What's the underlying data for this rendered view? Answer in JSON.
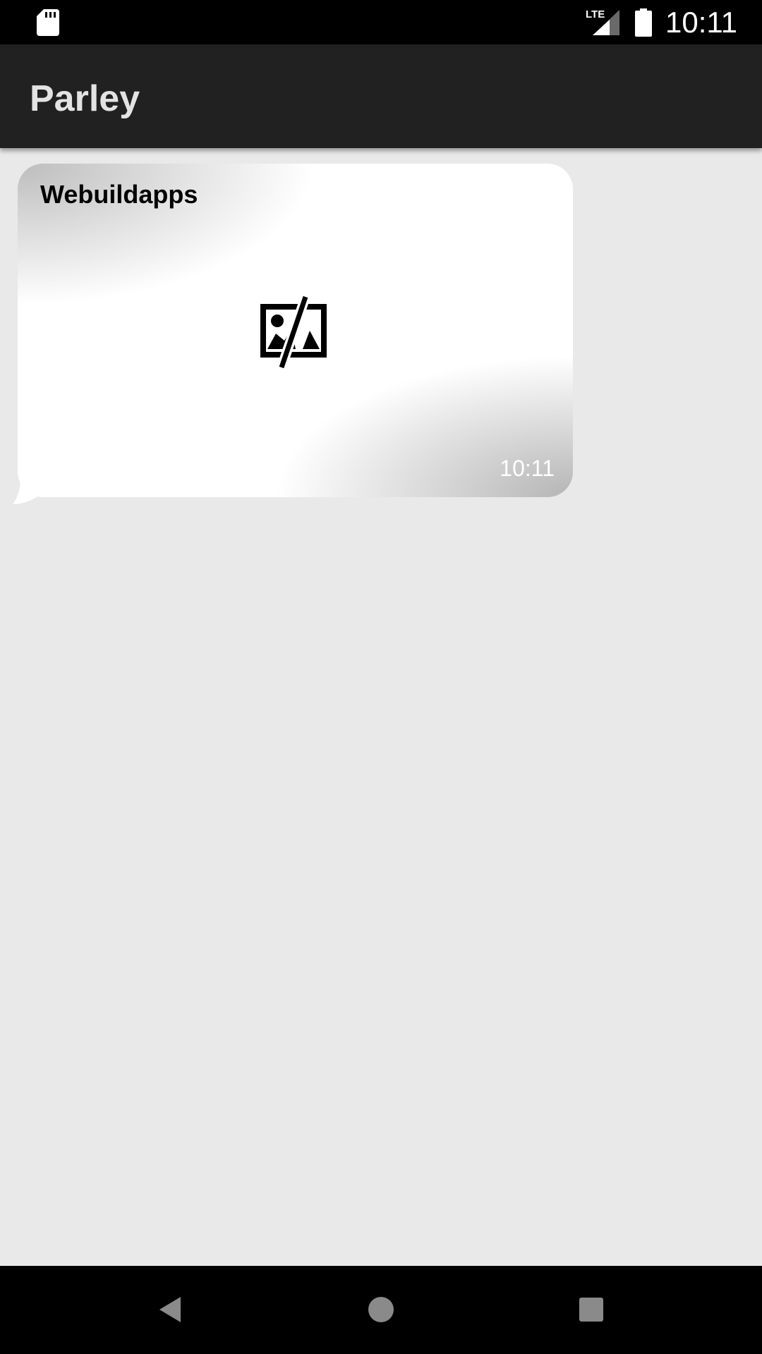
{
  "status_bar": {
    "time": "10:11",
    "network_label": "LTE",
    "icons": [
      "sd-card-icon",
      "lte-signal-icon",
      "battery-icon"
    ]
  },
  "app_bar": {
    "title": "Parley"
  },
  "messages": [
    {
      "sender": "Webuildapps",
      "content_icon": "broken-image-icon",
      "time": "10:11"
    }
  ],
  "nav_bar": {
    "icons": [
      "back-icon",
      "home-icon",
      "recents-icon"
    ]
  },
  "colors": {
    "status_bar_bg": "#000000",
    "app_bar_bg": "#212121",
    "app_title": "#e3e3e3",
    "content_bg": "#e9e9e9",
    "bubble_bg": "#ffffff",
    "nav_bar_bg": "#000000",
    "nav_icon": "#8a8a8a"
  }
}
